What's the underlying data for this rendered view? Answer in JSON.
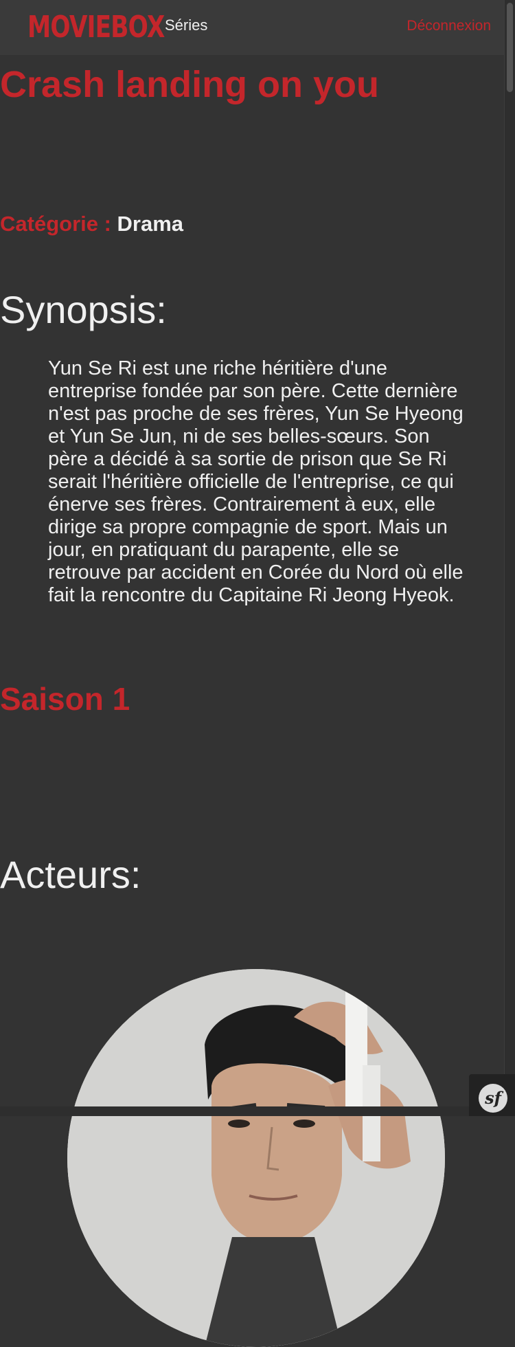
{
  "nav": {
    "logo_main": "Movie",
    "logo_box": "Box",
    "series_label": "Séries",
    "logout_label": "Déconnexion"
  },
  "show": {
    "title": "Crash landing on you",
    "category_label": "Catégorie :",
    "category_value": "Drama",
    "synopsis_heading": "Synopsis:",
    "synopsis": "Yun Se Ri est une riche héritière d'une entreprise fondée par son père. Cette dernière n'est pas proche de ses frères, Yun Se Hyeong et Yun Se Jun, ni de ses belles-sœurs. Son père a décidé à sa sortie de prison que Se Ri serait l'héritière officielle de l'entreprise, ce qui énerve ses frères. Contrairement à eux, elle dirige sa propre compagnie de sport. Mais un jour, en pratiquant du parapente, elle se retrouve par accident en Corée du Nord où elle fait la rencontre du Capitaine Ri Jeong Hyeok.",
    "season_label": "Saison 1",
    "actors_heading": "Acteurs:"
  },
  "debug_toolbar": {
    "icon": "sf"
  },
  "colors": {
    "background": "#333333",
    "navbar": "#3a3a3a",
    "accent": "#c4262b",
    "text": "#f0f0f0"
  }
}
